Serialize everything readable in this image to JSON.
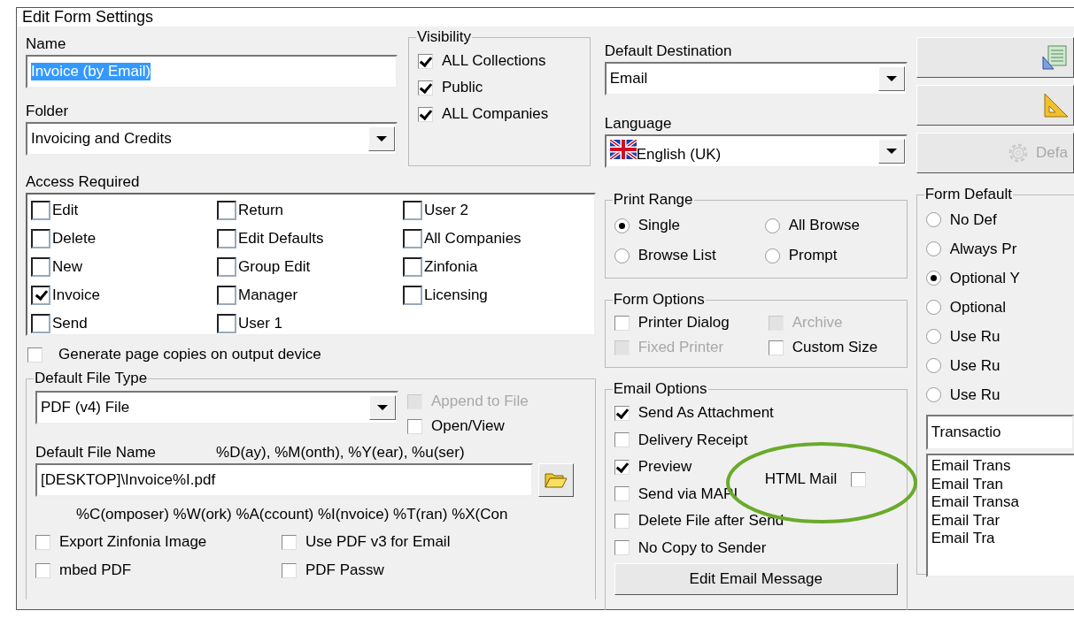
{
  "window": {
    "title": "Edit Form Settings"
  },
  "name": {
    "label": "Name",
    "value": "Invoice (by Email)"
  },
  "folder": {
    "label": "Folder",
    "value": "Invoicing and Credits"
  },
  "visibility": {
    "title": "Visibility",
    "options": [
      {
        "label": "ALL Collections",
        "checked": true
      },
      {
        "label": "Public",
        "checked": true
      },
      {
        "label": "ALL Companies",
        "checked": true
      }
    ]
  },
  "access": {
    "label": "Access Required",
    "items": [
      {
        "label": "Edit",
        "checked": false
      },
      {
        "label": "Delete",
        "checked": false
      },
      {
        "label": "New",
        "checked": false
      },
      {
        "label": "Invoice",
        "checked": true
      },
      {
        "label": "Send",
        "checked": false
      },
      {
        "label": "Return",
        "checked": false
      },
      {
        "label": "Edit Defaults",
        "checked": false
      },
      {
        "label": "Group Edit",
        "checked": false
      },
      {
        "label": "Manager",
        "checked": false
      },
      {
        "label": "User 1",
        "checked": false
      },
      {
        "label": "User 2",
        "checked": false
      },
      {
        "label": "All Companies",
        "checked": false
      },
      {
        "label": "Zinfonia",
        "checked": false
      },
      {
        "label": "Licensing",
        "checked": false
      }
    ]
  },
  "generate_copies": {
    "label": "Generate page copies on output device",
    "checked": false,
    "disabled": false
  },
  "file_type": {
    "title": "Default File Type",
    "value": "PDF (v4) File",
    "side_options": [
      {
        "label": "Append to File",
        "checked": false,
        "disabled": true
      },
      {
        "label": "Open/View",
        "checked": false,
        "disabled": false
      }
    ],
    "file_name_label": "Default File Name",
    "tokens_top": "%D(ay), %M(onth), %Y(ear), %u(ser)",
    "file_name": "[DESKTOP]\\Invoice%I.pdf",
    "tokens_bottom": "%C(omposer) %W(ork) %A(ccount) %I(nvoice) %T(ran) %X(Con",
    "options": [
      {
        "label": "Export Zinfonia Image",
        "checked": false,
        "disabled": false
      },
      {
        "label": "Use PDF v3 for Email",
        "checked": false,
        "disabled": false
      },
      {
        "label": "mbed PDF",
        "checked": false,
        "disabled": false
      },
      {
        "label": "PDF Passw",
        "checked": false,
        "disabled": false
      }
    ]
  },
  "destination": {
    "label": "Default Destination",
    "value": "Email"
  },
  "language": {
    "label": "Language",
    "value": "English (UK)"
  },
  "print_range": {
    "title": "Print Range",
    "options": [
      {
        "label": "Single",
        "selected": true
      },
      {
        "label": "All Browse",
        "selected": false
      },
      {
        "label": "Browse List",
        "selected": false
      },
      {
        "label": "Prompt",
        "selected": false
      }
    ]
  },
  "form_options": {
    "title": "Form Options",
    "options": [
      {
        "label": "Printer Dialog",
        "checked": false,
        "disabled": false
      },
      {
        "label": "Archive",
        "checked": false,
        "disabled": true
      },
      {
        "label": "Fixed Printer",
        "checked": false,
        "disabled": true
      },
      {
        "label": "Custom Size",
        "checked": false,
        "disabled": false
      }
    ]
  },
  "email_options": {
    "title": "Email Options",
    "options": [
      {
        "label": "Send As Attachment",
        "checked": true,
        "disabled": false
      },
      {
        "label": "Delivery Receipt",
        "checked": false,
        "disabled": false
      },
      {
        "label": "Preview",
        "checked": true,
        "disabled": false
      },
      {
        "label": "Send via MAPI",
        "checked": false,
        "disabled": false
      },
      {
        "label": "Delete File after Send",
        "checked": false,
        "disabled": false
      },
      {
        "label": "No Copy to Sender",
        "checked": false,
        "disabled": false
      }
    ],
    "html_mail": {
      "label": "HTML Mail",
      "checked": false,
      "disabled": false
    },
    "button": "Edit Email Message"
  },
  "side_buttons": [
    {
      "kind": "report",
      "disabled": false
    },
    {
      "kind": "ruler",
      "disabled": false
    },
    {
      "kind": "gear",
      "label": "Defa",
      "disabled": true
    }
  ],
  "form_defaults": {
    "title": "Form Default",
    "options": [
      {
        "label": "No Def",
        "selected": false
      },
      {
        "label": "Always Pr",
        "selected": false
      },
      {
        "label": "Optional Y",
        "selected": true
      },
      {
        "label": "Optional",
        "selected": false
      },
      {
        "label": "Use Ru",
        "selected": false
      },
      {
        "label": "Use Ru",
        "selected": false
      },
      {
        "label": "Use Ru",
        "selected": false
      }
    ]
  },
  "transaction": {
    "value": "Transactio",
    "items": [
      "Email Trans",
      "Email Tran",
      "Email Transa",
      "Email Trar",
      "Email Tra"
    ]
  }
}
